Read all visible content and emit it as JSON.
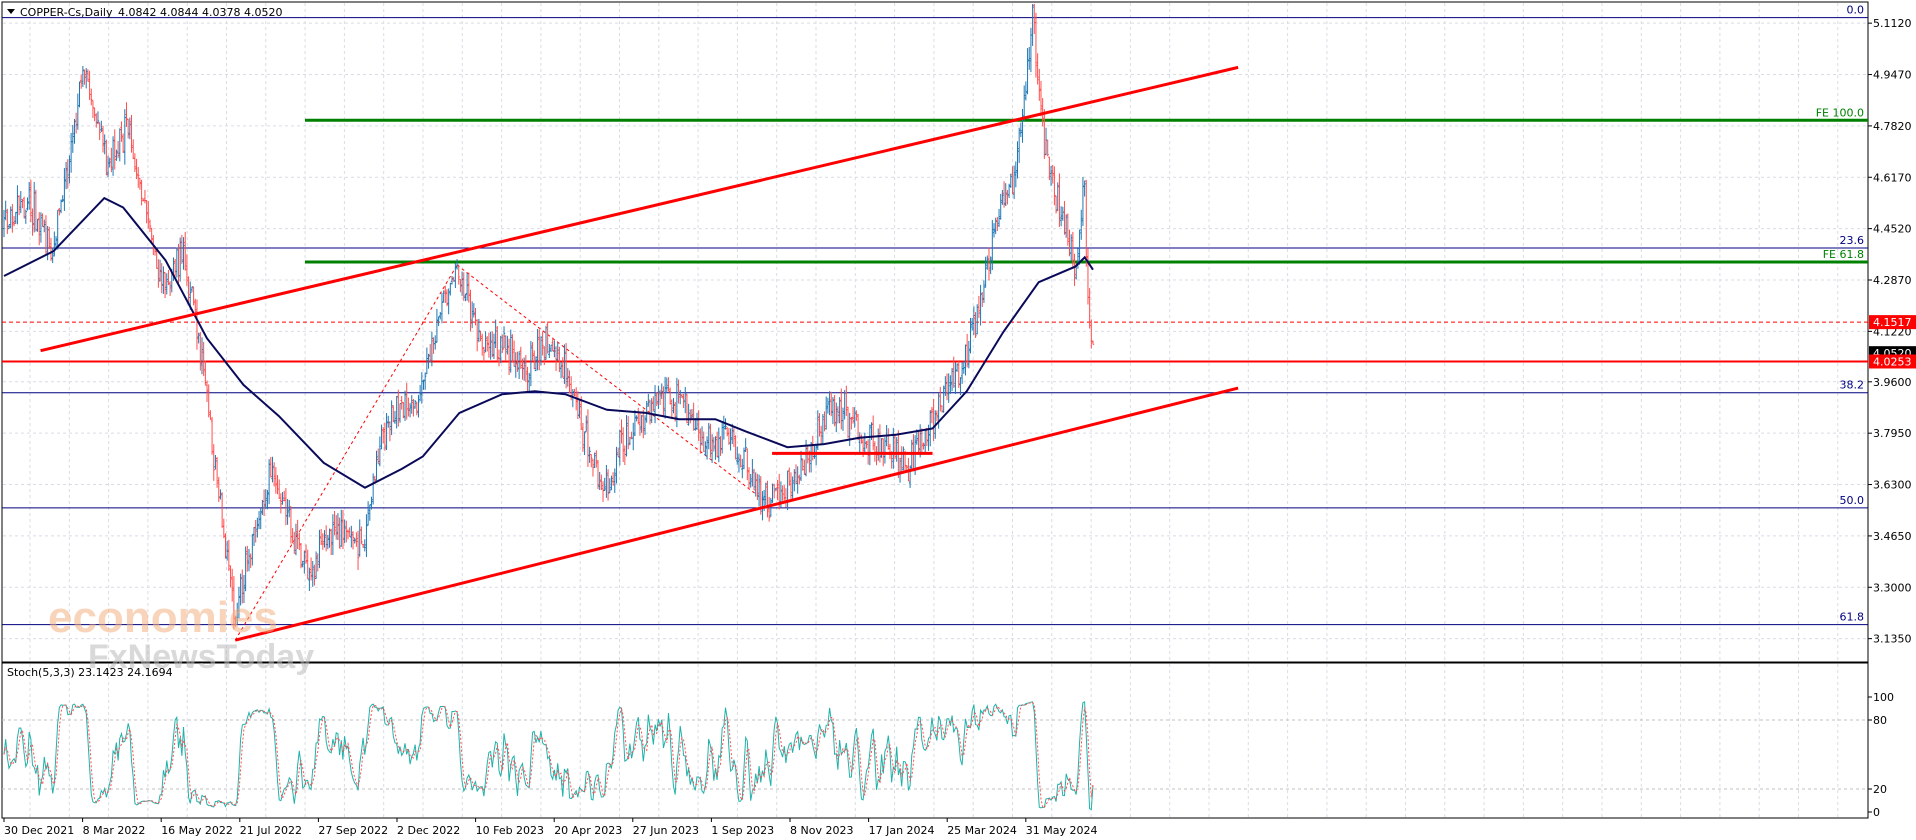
{
  "header": {
    "symbol_label": "COPPER-Cs,Daily",
    "ohlc": "4.0842 4.0844 4.0378 4.0520"
  },
  "watermark": {
    "line1": "economies",
    "line2": "FxNewsToday"
  },
  "colors": {
    "bull": "#1f77b4",
    "bear": "#ff4d4d",
    "ma": "#0a0a5a",
    "channel": "#ff0000",
    "fe": "#008000",
    "fib": "#000080",
    "grid": "#d8dce6",
    "stoch_main": "#20b2aa",
    "stoch_signal": "#ff4d4d"
  },
  "chart_data": [
    {
      "type": "line",
      "title": "COPPER-Cs,Daily",
      "ylim": [
        3.06,
        5.18
      ],
      "x_range": [
        "2021-12-30",
        "2024-07-10"
      ],
      "y_ticks": [
        "5.1120",
        "4.9470",
        "4.7820",
        "4.6170",
        "4.4520",
        "4.2870",
        "4.1220",
        "3.9600",
        "3.7950",
        "3.6300",
        "3.4650",
        "3.3000",
        "3.1350"
      ],
      "x_ticks": [
        "30 Dec 2021",
        "8 Mar 2022",
        "16 May 2022",
        "21 Jul 2022",
        "27 Sep 2022",
        "2 Dec 2022",
        "10 Feb 2023",
        "20 Apr 2023",
        "27 Jun 2023",
        "1 Sep 2023",
        "8 Nov 2023",
        "17 Jan 2024",
        "25 Mar 2024",
        "31 May 2024"
      ],
      "price_path": [
        {
          "x": "2021-12-30",
          "y": 4.45
        },
        {
          "x": "2022-01-20",
          "y": 4.55
        },
        {
          "x": "2022-02-10",
          "y": 4.38
        },
        {
          "x": "2022-03-08",
          "y": 4.98
        },
        {
          "x": "2022-03-25",
          "y": 4.68
        },
        {
          "x": "2022-04-15",
          "y": 4.76
        },
        {
          "x": "2022-05-05",
          "y": 4.4
        },
        {
          "x": "2022-05-16",
          "y": 4.22
        },
        {
          "x": "2022-05-30",
          "y": 4.38
        },
        {
          "x": "2022-06-15",
          "y": 4.05
        },
        {
          "x": "2022-07-05",
          "y": 3.45
        },
        {
          "x": "2022-07-14",
          "y": 3.2
        },
        {
          "x": "2022-07-28",
          "y": 3.45
        },
        {
          "x": "2022-08-15",
          "y": 3.68
        },
        {
          "x": "2022-09-01",
          "y": 3.45
        },
        {
          "x": "2022-09-15",
          "y": 3.35
        },
        {
          "x": "2022-09-27",
          "y": 3.45
        },
        {
          "x": "2022-10-15",
          "y": 3.5
        },
        {
          "x": "2022-10-31",
          "y": 3.42
        },
        {
          "x": "2022-11-15",
          "y": 3.8
        },
        {
          "x": "2022-11-28",
          "y": 3.87
        },
        {
          "x": "2022-12-15",
          "y": 3.9
        },
        {
          "x": "2023-01-05",
          "y": 4.2
        },
        {
          "x": "2023-01-18",
          "y": 4.3
        },
        {
          "x": "2023-02-10",
          "y": 4.08
        },
        {
          "x": "2023-03-01",
          "y": 4.08
        },
        {
          "x": "2023-03-20",
          "y": 4.0
        },
        {
          "x": "2023-04-05",
          "y": 4.1
        },
        {
          "x": "2023-04-20",
          "y": 4.0
        },
        {
          "x": "2023-05-10",
          "y": 3.75
        },
        {
          "x": "2023-05-25",
          "y": 3.6
        },
        {
          "x": "2023-06-10",
          "y": 3.8
        },
        {
          "x": "2023-06-27",
          "y": 3.85
        },
        {
          "x": "2023-07-15",
          "y": 3.95
        },
        {
          "x": "2023-08-01",
          "y": 3.85
        },
        {
          "x": "2023-08-20",
          "y": 3.75
        },
        {
          "x": "2023-09-01",
          "y": 3.8
        },
        {
          "x": "2023-09-20",
          "y": 3.7
        },
        {
          "x": "2023-10-05",
          "y": 3.58
        },
        {
          "x": "2023-10-20",
          "y": 3.6
        },
        {
          "x": "2023-11-08",
          "y": 3.7
        },
        {
          "x": "2023-11-25",
          "y": 3.85
        },
        {
          "x": "2023-12-10",
          "y": 3.88
        },
        {
          "x": "2023-12-28",
          "y": 3.78
        },
        {
          "x": "2024-01-17",
          "y": 3.75
        },
        {
          "x": "2024-02-05",
          "y": 3.7
        },
        {
          "x": "2024-02-20",
          "y": 3.8
        },
        {
          "x": "2024-03-08",
          "y": 3.95
        },
        {
          "x": "2024-03-25",
          "y": 4.05
        },
        {
          "x": "2024-04-05",
          "y": 4.2
        },
        {
          "x": "2024-04-20",
          "y": 4.5
        },
        {
          "x": "2024-05-05",
          "y": 4.62
        },
        {
          "x": "2024-05-20",
          "y": 5.12
        },
        {
          "x": "2024-05-31",
          "y": 4.7
        },
        {
          "x": "2024-06-15",
          "y": 4.45
        },
        {
          "x": "2024-06-25",
          "y": 4.33
        },
        {
          "x": "2024-07-03",
          "y": 4.6
        },
        {
          "x": "2024-07-06",
          "y": 4.2
        },
        {
          "x": "2024-07-10",
          "y": 4.05
        }
      ],
      "moving_average": [
        {
          "x": "2021-12-30",
          "y": 4.3
        },
        {
          "x": "2022-02-10",
          "y": 4.38
        },
        {
          "x": "2022-03-25",
          "y": 4.55
        },
        {
          "x": "2022-04-10",
          "y": 4.52
        },
        {
          "x": "2022-05-16",
          "y": 4.35
        },
        {
          "x": "2022-06-20",
          "y": 4.1
        },
        {
          "x": "2022-07-21",
          "y": 3.95
        },
        {
          "x": "2022-08-20",
          "y": 3.85
        },
        {
          "x": "2022-09-27",
          "y": 3.7
        },
        {
          "x": "2022-11-01",
          "y": 3.62
        },
        {
          "x": "2022-12-02",
          "y": 3.68
        },
        {
          "x": "2022-12-20",
          "y": 3.72
        },
        {
          "x": "2023-01-20",
          "y": 3.86
        },
        {
          "x": "2023-02-25",
          "y": 3.92
        },
        {
          "x": "2023-03-25",
          "y": 3.93
        },
        {
          "x": "2023-04-20",
          "y": 3.92
        },
        {
          "x": "2023-05-25",
          "y": 3.87
        },
        {
          "x": "2023-06-27",
          "y": 3.86
        },
        {
          "x": "2023-07-25",
          "y": 3.84
        },
        {
          "x": "2023-08-25",
          "y": 3.84
        },
        {
          "x": "2023-09-20",
          "y": 3.8
        },
        {
          "x": "2023-10-25",
          "y": 3.75
        },
        {
          "x": "2023-11-25",
          "y": 3.76
        },
        {
          "x": "2023-12-25",
          "y": 3.78
        },
        {
          "x": "2024-01-25",
          "y": 3.79
        },
        {
          "x": "2024-02-25",
          "y": 3.81
        },
        {
          "x": "2024-03-25",
          "y": 3.93
        },
        {
          "x": "2024-04-25",
          "y": 4.12
        },
        {
          "x": "2024-05-25",
          "y": 4.28
        },
        {
          "x": "2024-06-25",
          "y": 4.33
        },
        {
          "x": "2024-07-03",
          "y": 4.36
        },
        {
          "x": "2024-07-10",
          "y": 4.32
        }
      ],
      "fib_levels": [
        {
          "label": "0.0",
          "value": 5.13
        },
        {
          "label": "23.6",
          "value": 4.39
        },
        {
          "label": "38.2",
          "value": 3.925
        },
        {
          "label": "50.0",
          "value": 3.555
        },
        {
          "label": "61.8",
          "value": 3.18
        }
      ],
      "fe_levels": [
        {
          "label": "FE 100.0",
          "value": 4.8
        },
        {
          "label": "FE 61.8",
          "value": 4.345
        }
      ],
      "price_lines": [
        {
          "label": "4.1517",
          "value": 4.1517,
          "color": "#ff0000",
          "style": "dashed"
        },
        {
          "label": "4.0520",
          "value": 4.052,
          "color": "#000000",
          "style": "none"
        },
        {
          "label": "4.0253",
          "value": 4.0253,
          "color": "#ff0000",
          "style": "solid"
        }
      ],
      "channel_lines": [
        {
          "from": {
            "x": "2022-01-30",
            "y": 4.06
          },
          "to": {
            "x": "2024-11-10",
            "y": 4.97
          }
        },
        {
          "from": {
            "x": "2022-07-14",
            "y": 3.13
          },
          "to": {
            "x": "2024-11-10",
            "y": 3.94
          }
        }
      ],
      "support_segment": {
        "from": {
          "x": "2023-10-12",
          "y": 3.73
        },
        "to": {
          "x": "2024-02-25",
          "y": 3.73
        }
      },
      "swing_lines": [
        {
          "from": {
            "x": "2022-07-14",
            "y": 3.13
          },
          "to": {
            "x": "2023-01-18",
            "y": 4.335
          }
        },
        {
          "from": {
            "x": "2023-01-18",
            "y": 4.335
          },
          "to": {
            "x": "2023-10-05",
            "y": 3.58
          }
        }
      ]
    },
    {
      "type": "line",
      "title": "Stoch(5,3,3) 23.1423 24.1694",
      "ylim": [
        0,
        100
      ],
      "y_ticks": [
        "100",
        "80",
        "20",
        "0"
      ],
      "levels": [
        80,
        20
      ],
      "main_last": 23.1423,
      "signal_last": 24.1694
    }
  ]
}
